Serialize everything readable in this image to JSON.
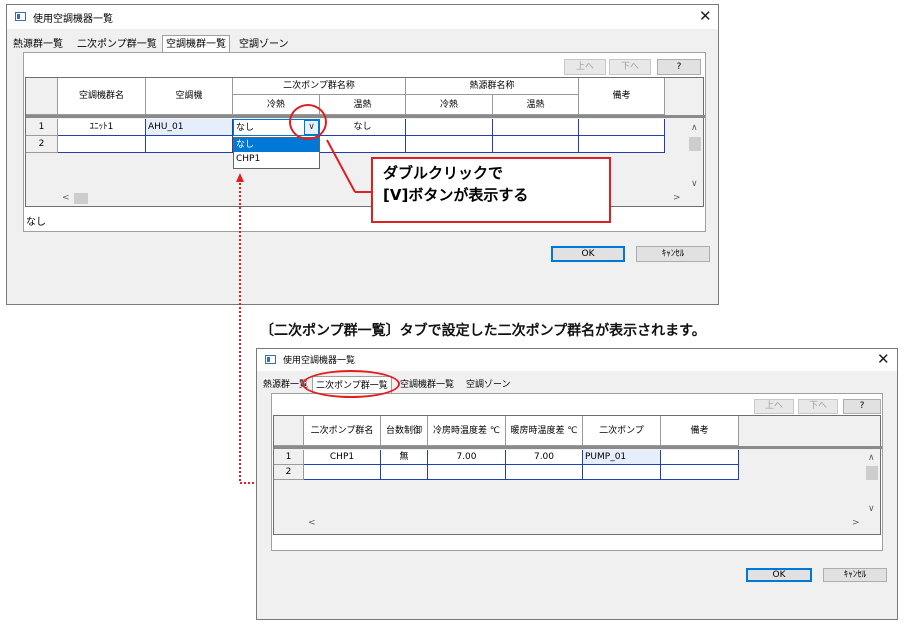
{
  "window1": {
    "title": "使用空調機器一覧",
    "tabs": [
      "熱源群一覧",
      "二次ポンプ群一覧",
      "空調機群一覧",
      "空調ゾーン"
    ],
    "active_tab": 2,
    "buttons": {
      "up": "上へ",
      "down": "下へ",
      "help": "?",
      "ok": "OK",
      "cancel": "ｷｬﾝｾﾙ"
    },
    "headers": {
      "group_name": "空調機群名",
      "unit": "空調機",
      "pump_group": "二次ポンプ群名称",
      "pump_cool": "冷熱",
      "pump_heat": "温熱",
      "heat_group": "熱源群名称",
      "heat_cool": "冷熱",
      "heat_heat": "温熱",
      "note": "備考"
    },
    "rows": [
      {
        "num": "1",
        "group_name": "ﾕﾆｯﾄ1",
        "unit": "AHU_01",
        "pump_cool": "なし",
        "pump_heat": "なし",
        "heat_cool": "",
        "heat_heat": "",
        "note": ""
      },
      {
        "num": "2",
        "group_name": "",
        "unit": "",
        "pump_cool": "",
        "pump_heat": "",
        "heat_cool": "",
        "heat_heat": "",
        "note": ""
      }
    ],
    "dropdown_options": [
      "なし",
      "CHP1"
    ],
    "status_text": "なし"
  },
  "callout": {
    "line1": "ダブルクリックで",
    "line2": "[V]ボタンが表示する"
  },
  "annotation": "〔二次ポンプ群一覧〕タブで設定した二次ポンプ群名が表示されます。",
  "window2": {
    "title": "使用空調機器一覧",
    "tabs": [
      "熱源群一覧",
      "二次ポンプ群一覧",
      "空調機群一覧",
      "空調ゾーン"
    ],
    "active_tab": 1,
    "buttons": {
      "up": "上へ",
      "down": "下へ",
      "help": "?",
      "ok": "OK",
      "cancel": "ｷｬﾝｾﾙ"
    },
    "headers": [
      "二次ポンプ群名",
      "台数制御",
      "冷房時温度差 ℃",
      "暖房時温度差 ℃",
      "二次ポンプ",
      "備考"
    ],
    "rows": [
      {
        "num": "1",
        "cells": [
          "CHP1",
          "無",
          "7.00",
          "7.00",
          "PUMP_01",
          ""
        ]
      },
      {
        "num": "2",
        "cells": [
          "",
          "",
          "",
          "",
          "",
          ""
        ]
      }
    ]
  },
  "colors": {
    "highlight": "#e02020",
    "selection": "#0078d7",
    "grid_line": "#2040b0"
  },
  "icons": [
    "app-icon",
    "close-icon",
    "scroll-up-icon",
    "scroll-down-icon",
    "scroll-left-icon",
    "scroll-right-icon",
    "dropdown-chevron-icon"
  ]
}
